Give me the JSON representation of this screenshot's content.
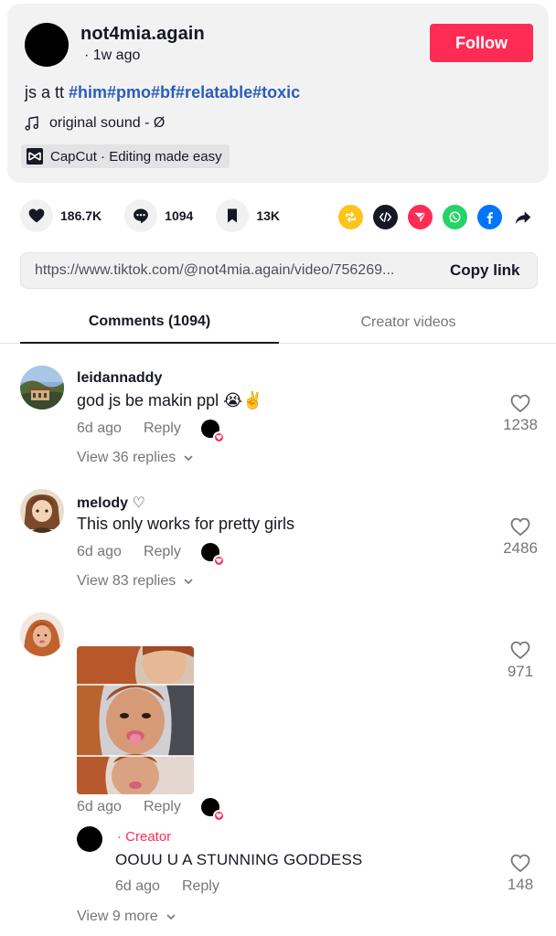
{
  "post": {
    "author": "not4mia.again",
    "time": "· 1w ago",
    "follow_label": "Follow",
    "desc_plain": "js a tt ",
    "hashtags": [
      "#him",
      "#pmo",
      "#bf",
      "#relatable",
      "#toxic"
    ],
    "music": "original sound - Ø",
    "capcut_label": "CapCut · Editing made easy"
  },
  "actions": {
    "likes": "186.7K",
    "comments": "1094",
    "saves": "13K"
  },
  "share": {
    "icons": [
      "repost-icon",
      "embed-icon",
      "send-icon",
      "whatsapp-icon",
      "facebook-icon",
      "share-arrow-icon"
    ],
    "colors": {
      "repost": "#ffc31a",
      "embed": "#161823",
      "send": "#fe2c55",
      "whatsapp": "#25d366",
      "facebook": "#0075fa"
    }
  },
  "link": {
    "url": "https://www.tiktok.com/@not4mia.again/video/756269...",
    "copy_label": "Copy link"
  },
  "tabs": {
    "comments": "Comments (1094)",
    "creator_videos": "Creator videos"
  },
  "comments": [
    {
      "user": "leidannaddy",
      "text": "god js be makin ppl 😭✌️",
      "time": "6d ago",
      "reply": "Reply",
      "likes": "1238",
      "view": "View 36 replies"
    },
    {
      "user": "melody ♡",
      "text": "This only works for pretty girls",
      "time": "6d ago",
      "reply": "Reply",
      "likes": "2486",
      "view": "View 83 replies"
    },
    {
      "user": "",
      "time": "6d ago",
      "reply": "Reply",
      "likes": "971",
      "creator_reply": {
        "badge": "· Creator",
        "text": "OOUU U A STUNNING GODDESS",
        "time": "6d ago",
        "reply": "Reply",
        "likes": "148"
      },
      "view": "View 9 more"
    }
  ],
  "theme": {
    "accent": "#fe2c55",
    "hashtag": "#2b5db9",
    "muted": "#75757c"
  }
}
